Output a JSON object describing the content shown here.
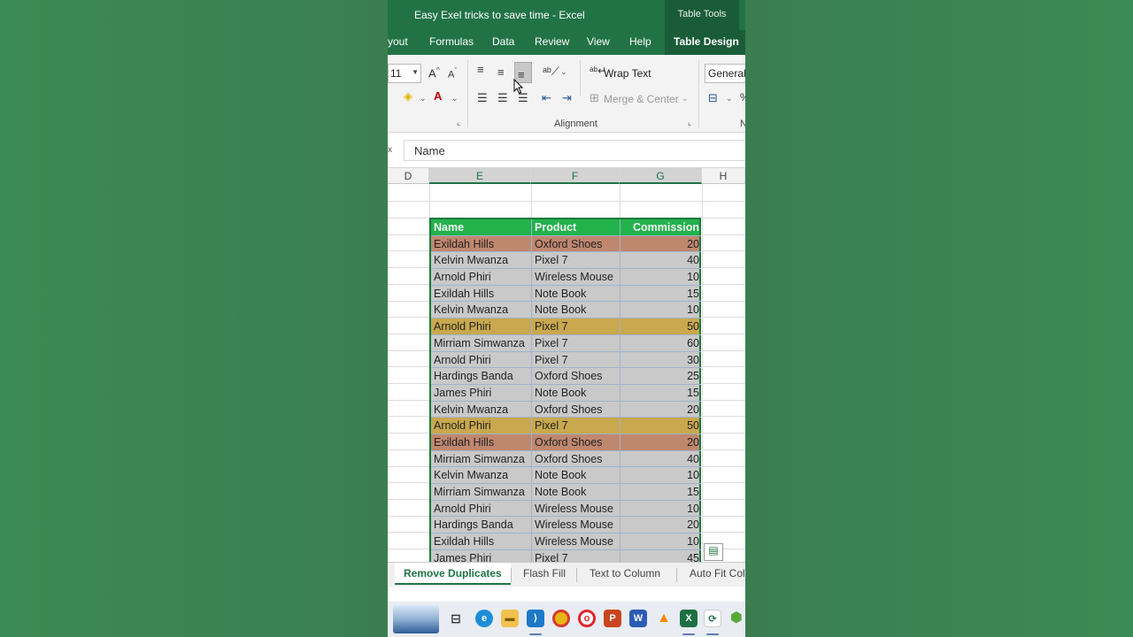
{
  "window": {
    "title": "Easy Exel tricks to save time  -  Excel",
    "context_tab": "Table Tools"
  },
  "ribbon_tabs": [
    "yout",
    "Formulas",
    "Data",
    "Review",
    "View",
    "Help",
    "Table Design"
  ],
  "ribbon": {
    "font_size": "11",
    "wrap_text": "Wrap Text",
    "merge_center": "Merge & Center",
    "number_format": "General",
    "group_alignment": "Alignment",
    "group_number_partial": "N"
  },
  "formula_bar": {
    "fx_partial": "x",
    "value": "Name"
  },
  "columns": [
    "D",
    "E",
    "F",
    "G",
    "H"
  ],
  "table": {
    "headers": [
      "Name",
      "Product",
      "Commission"
    ],
    "rows": [
      {
        "name": "Exildah Hills",
        "product": "Oxford Shoes",
        "commission": "20",
        "fill": "#c0876f"
      },
      {
        "name": "Kelvin Mwanza",
        "product": "Pixel 7",
        "commission": "40",
        "fill": "#c9c9c9"
      },
      {
        "name": "Arnold Phiri",
        "product": "Wireless Mouse",
        "commission": "10",
        "fill": "#c9c9c9"
      },
      {
        "name": "Exildah Hills",
        "product": "Note Book",
        "commission": "15",
        "fill": "#c9c9c9"
      },
      {
        "name": "Kelvin Mwanza",
        "product": "Note Book",
        "commission": "10",
        "fill": "#c9c9c9"
      },
      {
        "name": "Arnold Phiri",
        "product": "Pixel 7",
        "commission": "50",
        "fill": "#c9a84e"
      },
      {
        "name": "Mirriam Simwanza",
        "product": "Pixel 7",
        "commission": "60",
        "fill": "#c9c9c9"
      },
      {
        "name": "Arnold Phiri",
        "product": "Pixel 7",
        "commission": "30",
        "fill": "#c9c9c9"
      },
      {
        "name": "Hardings Banda",
        "product": "Oxford Shoes",
        "commission": "25",
        "fill": "#c9c9c9"
      },
      {
        "name": "James Phiri",
        "product": "Note Book",
        "commission": "15",
        "fill": "#c9c9c9"
      },
      {
        "name": "Kelvin Mwanza",
        "product": "Oxford Shoes",
        "commission": "20",
        "fill": "#c9c9c9"
      },
      {
        "name": "Arnold Phiri",
        "product": "Pixel 7",
        "commission": "50",
        "fill": "#c9a84e"
      },
      {
        "name": "Exildah Hills",
        "product": "Oxford Shoes",
        "commission": "20",
        "fill": "#c0876f"
      },
      {
        "name": "Mirriam Simwanza",
        "product": "Oxford Shoes",
        "commission": "40",
        "fill": "#c9c9c9"
      },
      {
        "name": "Kelvin Mwanza",
        "product": "Note Book",
        "commission": "10",
        "fill": "#c9c9c9"
      },
      {
        "name": "Mirriam Simwanza",
        "product": "Note Book",
        "commission": "15",
        "fill": "#c9c9c9"
      },
      {
        "name": "Arnold Phiri",
        "product": "Wireless Mouse",
        "commission": "10",
        "fill": "#c9c9c9"
      },
      {
        "name": "Hardings Banda",
        "product": "Wireless Mouse",
        "commission": "20",
        "fill": "#c9c9c9"
      },
      {
        "name": "Exildah Hills",
        "product": "Wireless Mouse",
        "commission": "10",
        "fill": "#c9c9c9"
      },
      {
        "name": "James Phiri",
        "product": "Pixel 7",
        "commission": "45",
        "fill": "#c9c9c9"
      }
    ]
  },
  "sheet_tabs": [
    "Remove Duplicates",
    "Flash Fill",
    "Text to Column",
    "Auto Fit Col"
  ],
  "colors": {
    "excel_green": "#217346",
    "header_fill": "#22b24c",
    "dup_orange": "#c0876f",
    "dup_gold": "#c9a84e",
    "row_gray": "#c9c9c9"
  },
  "taskbar_icons": [
    "task-view-icon",
    "edge-icon",
    "file-explorer-icon",
    "vscode-icon",
    "chrome-icon",
    "opera-icon",
    "powerpoint-icon",
    "word-icon",
    "vlc-icon",
    "excel-icon",
    "app-icon",
    "node-icon"
  ]
}
